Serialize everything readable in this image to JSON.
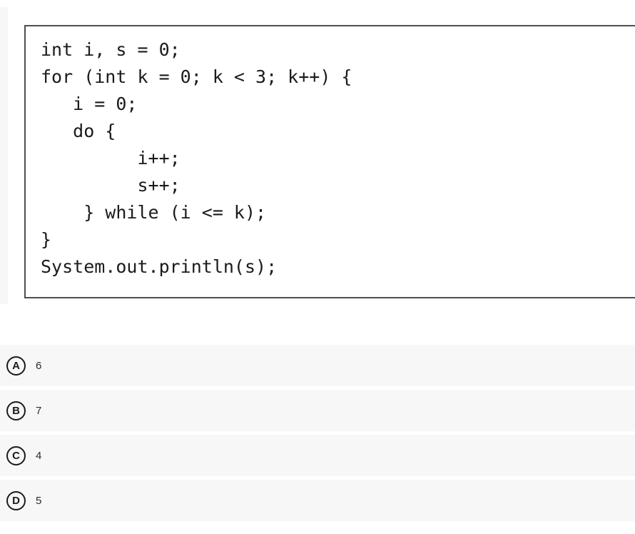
{
  "question": {
    "code_block": {
      "language": "java",
      "lines": [
        "int i, s = 0;",
        "for (int k = 0; k < 3; k++) {",
        "   i = 0;",
        "   do {",
        "         i++;",
        "         s++;",
        "    } while (i <= k);",
        "}",
        "System.out.println(s);"
      ],
      "text": "int i, s = 0;\nfor (int k = 0; k < 3; k++) {\n   i = 0;\n   do {\n         i++;\n         s++;\n    } while (i <= k);\n}\nSystem.out.println(s);",
      "border_color": "#4d4f53",
      "background_color": "#ffffff",
      "text_color": "#1b1b1b"
    },
    "options": [
      {
        "letter": "A",
        "text": "6"
      },
      {
        "letter": "B",
        "text": "7"
      },
      {
        "letter": "C",
        "text": "4"
      },
      {
        "letter": "D",
        "text": "5"
      }
    ],
    "option_row_background": "#f7f7f8",
    "gutter_color": "#f7f7f8"
  }
}
